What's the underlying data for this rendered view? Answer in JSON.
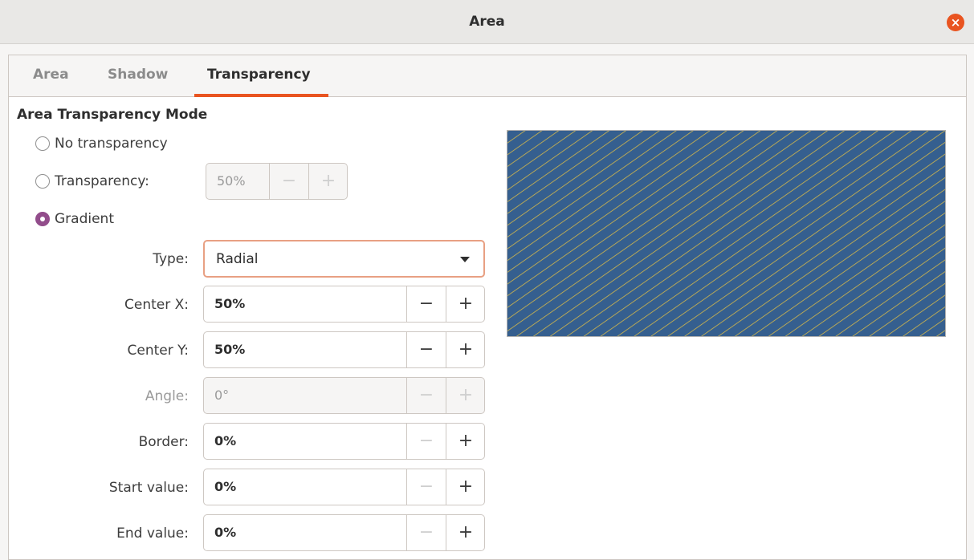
{
  "window": {
    "title": "Area"
  },
  "tabs": [
    {
      "label": "Area",
      "active": false
    },
    {
      "label": "Shadow",
      "active": false
    },
    {
      "label": "Transparency",
      "active": true
    }
  ],
  "section": {
    "title": "Area Transparency Mode"
  },
  "modes": {
    "no_transparency": {
      "label": "No transparency",
      "checked": false
    },
    "transparency": {
      "label": "Transparency:",
      "checked": false,
      "value": "50%"
    },
    "gradient": {
      "label": "Gradient",
      "checked": true
    }
  },
  "gradient": {
    "type": {
      "label": "Type:",
      "value": "Radial"
    },
    "fields": [
      {
        "label": "Center X:",
        "value": "50%",
        "enabled": true
      },
      {
        "label": "Center Y:",
        "value": "50%",
        "enabled": true
      },
      {
        "label": "Angle:",
        "value": "0°",
        "enabled": false
      },
      {
        "label": "Border:",
        "value": "0%",
        "enabled": true
      },
      {
        "label": "Start value:",
        "value": "0%",
        "enabled": true
      },
      {
        "label": "End value:",
        "value": "0%",
        "enabled": true
      }
    ]
  },
  "preview": {
    "background": "#355f8f",
    "stripe_color": "#d4b84a"
  },
  "colors": {
    "accent": "#e95420",
    "radio_checked": "#924d8b"
  }
}
